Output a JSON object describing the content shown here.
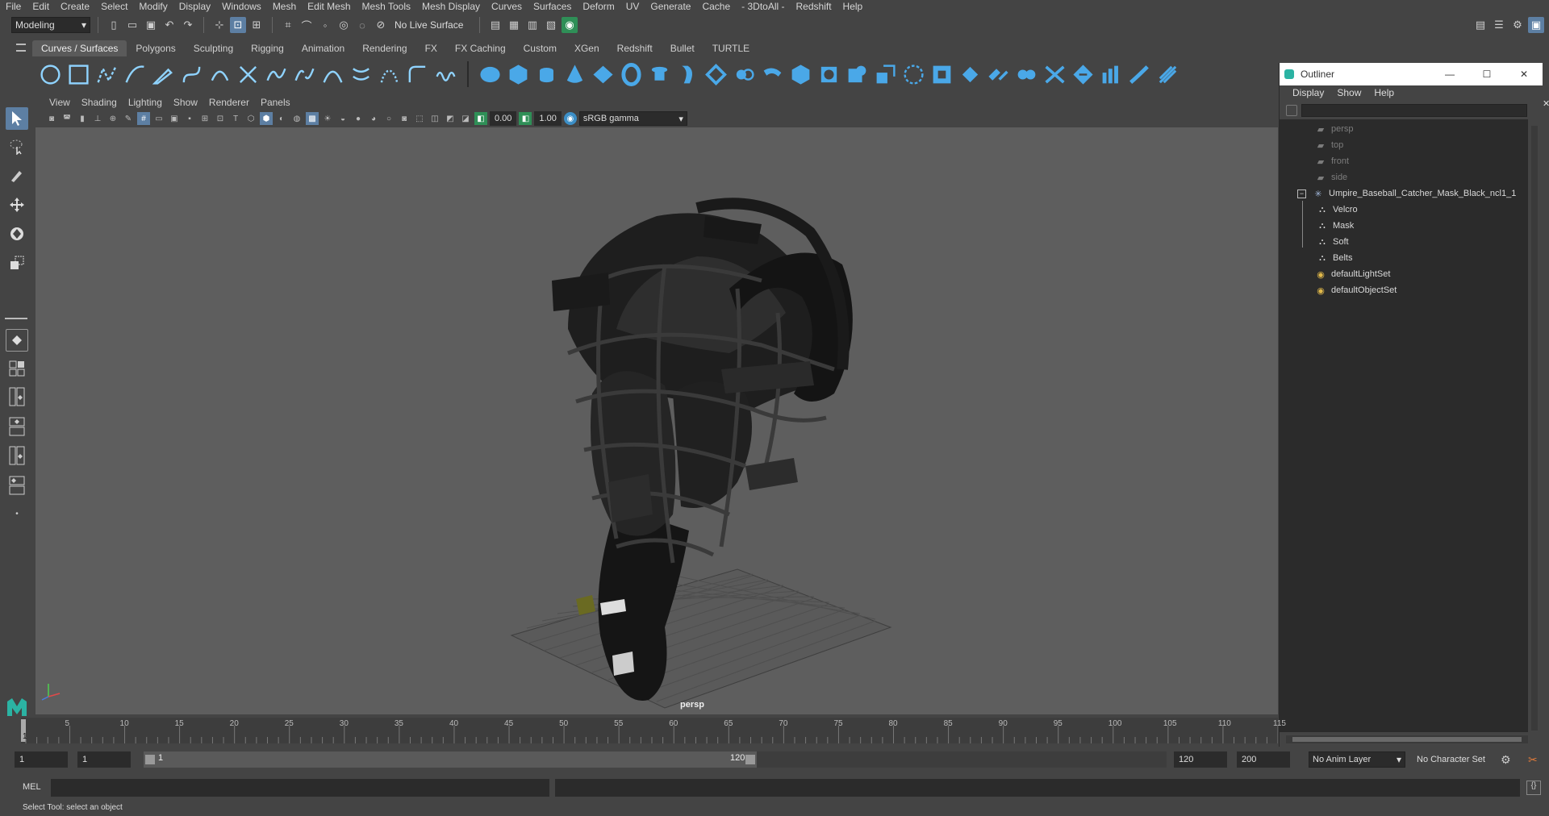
{
  "menubar": [
    "File",
    "Edit",
    "Create",
    "Select",
    "Modify",
    "Display",
    "Windows",
    "Mesh",
    "Edit Mesh",
    "Mesh Tools",
    "Mesh Display",
    "Curves",
    "Surfaces",
    "Deform",
    "UV",
    "Generate",
    "Cache",
    "- 3DtoAll -",
    "Redshift",
    "Help"
  ],
  "status": {
    "mode": "Modeling",
    "live_surface": "No Live Surface"
  },
  "shelf_tabs": [
    "Curves / Surfaces",
    "Polygons",
    "Sculpting",
    "Rigging",
    "Animation",
    "Rendering",
    "FX",
    "FX Caching",
    "Custom",
    "XGen",
    "Redshift",
    "Bullet",
    "TURTLE"
  ],
  "shelf_active": "Curves / Surfaces",
  "panel_menu": [
    "View",
    "Shading",
    "Lighting",
    "Show",
    "Renderer",
    "Panels"
  ],
  "panel_bar": {
    "exposure": "0.00",
    "gamma": "1.00",
    "colorspace": "sRGB gamma"
  },
  "viewport": {
    "camera": "persp"
  },
  "outliner": {
    "title": "Outliner",
    "menu": [
      "Display",
      "Show",
      "Help"
    ],
    "items": [
      {
        "label": "persp",
        "dim": true
      },
      {
        "label": "top",
        "dim": true
      },
      {
        "label": "front",
        "dim": true
      },
      {
        "label": "side",
        "dim": true
      },
      {
        "label": "Umpire_Baseball_Catcher_Mask_Black_ncl1_1",
        "dim": false
      },
      {
        "label": "Velcro",
        "dim": false
      },
      {
        "label": "Mask",
        "dim": false
      },
      {
        "label": "Soft",
        "dim": false
      },
      {
        "label": "Belts",
        "dim": false
      },
      {
        "label": "defaultLightSet",
        "dim": false
      },
      {
        "label": "defaultObjectSet",
        "dim": false
      }
    ]
  },
  "timeline": {
    "ticks": [
      "5",
      "10",
      "15",
      "20",
      "25",
      "30",
      "35",
      "40",
      "45",
      "50",
      "55",
      "60",
      "65",
      "70",
      "75",
      "80",
      "85",
      "90",
      "95",
      "100",
      "105",
      "110",
      "115"
    ],
    "current": "1"
  },
  "range": {
    "start": "1",
    "anim_start": "1",
    "slider_start": "1",
    "slider_end": "120",
    "end": "120",
    "anim_end": "200",
    "anim_layer": "No Anim Layer",
    "char_set": "No Character Set"
  },
  "cmd": {
    "label": "MEL"
  },
  "help": "Select Tool: select an object"
}
